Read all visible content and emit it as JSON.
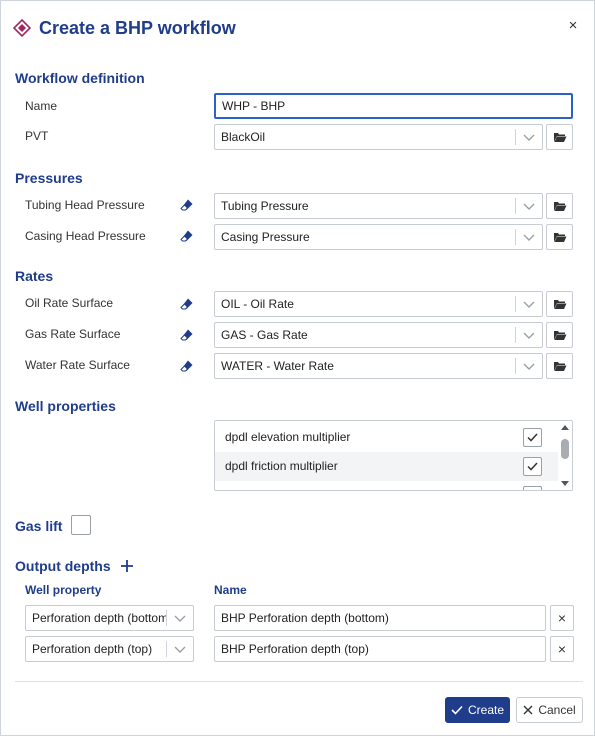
{
  "dialog": {
    "title": "Create a BHP workflow",
    "close_symbol": "×",
    "icons": {
      "title": "workflow-diamond-icon",
      "close": "close-icon"
    }
  },
  "workflow_definition": {
    "heading": "Workflow definition",
    "name_label": "Name",
    "name_value": "WHP - BHP",
    "pvt_label": "PVT",
    "pvt_value": "BlackOil"
  },
  "pressures": {
    "heading": "Pressures",
    "rows": [
      {
        "label": "Tubing Head Pressure",
        "value": "Tubing Pressure"
      },
      {
        "label": "Casing Head Pressure",
        "value": "Casing Pressure"
      }
    ]
  },
  "rates": {
    "heading": "Rates",
    "rows": [
      {
        "label": "Oil Rate Surface",
        "value": "OIL - Oil Rate"
      },
      {
        "label": "Gas Rate Surface",
        "value": "GAS - Gas Rate"
      },
      {
        "label": "Water Rate Surface",
        "value": "WATER - Water Rate"
      }
    ]
  },
  "well_properties": {
    "heading": "Well properties",
    "items": [
      {
        "label": "dpdl elevation multiplier",
        "checked": true
      },
      {
        "label": "dpdl friction multiplier",
        "checked": true
      }
    ]
  },
  "gas_lift": {
    "label": "Gas lift",
    "checked": false
  },
  "output_depths": {
    "heading": "Output depths",
    "col_well_property": "Well property",
    "col_name": "Name",
    "remove_symbol": "×",
    "rows": [
      {
        "well_property": "Perforation depth (bottom)",
        "name": "BHP Perforation depth (bottom)"
      },
      {
        "well_property": "Perforation depth (top)",
        "name": "BHP Perforation depth (top)"
      }
    ]
  },
  "footer": {
    "create_label": "Create",
    "cancel_label": "Cancel"
  },
  "colors": {
    "accent": "#1f3d8a",
    "focus_border": "#2a62c7",
    "title_icon": "#a3275f"
  }
}
